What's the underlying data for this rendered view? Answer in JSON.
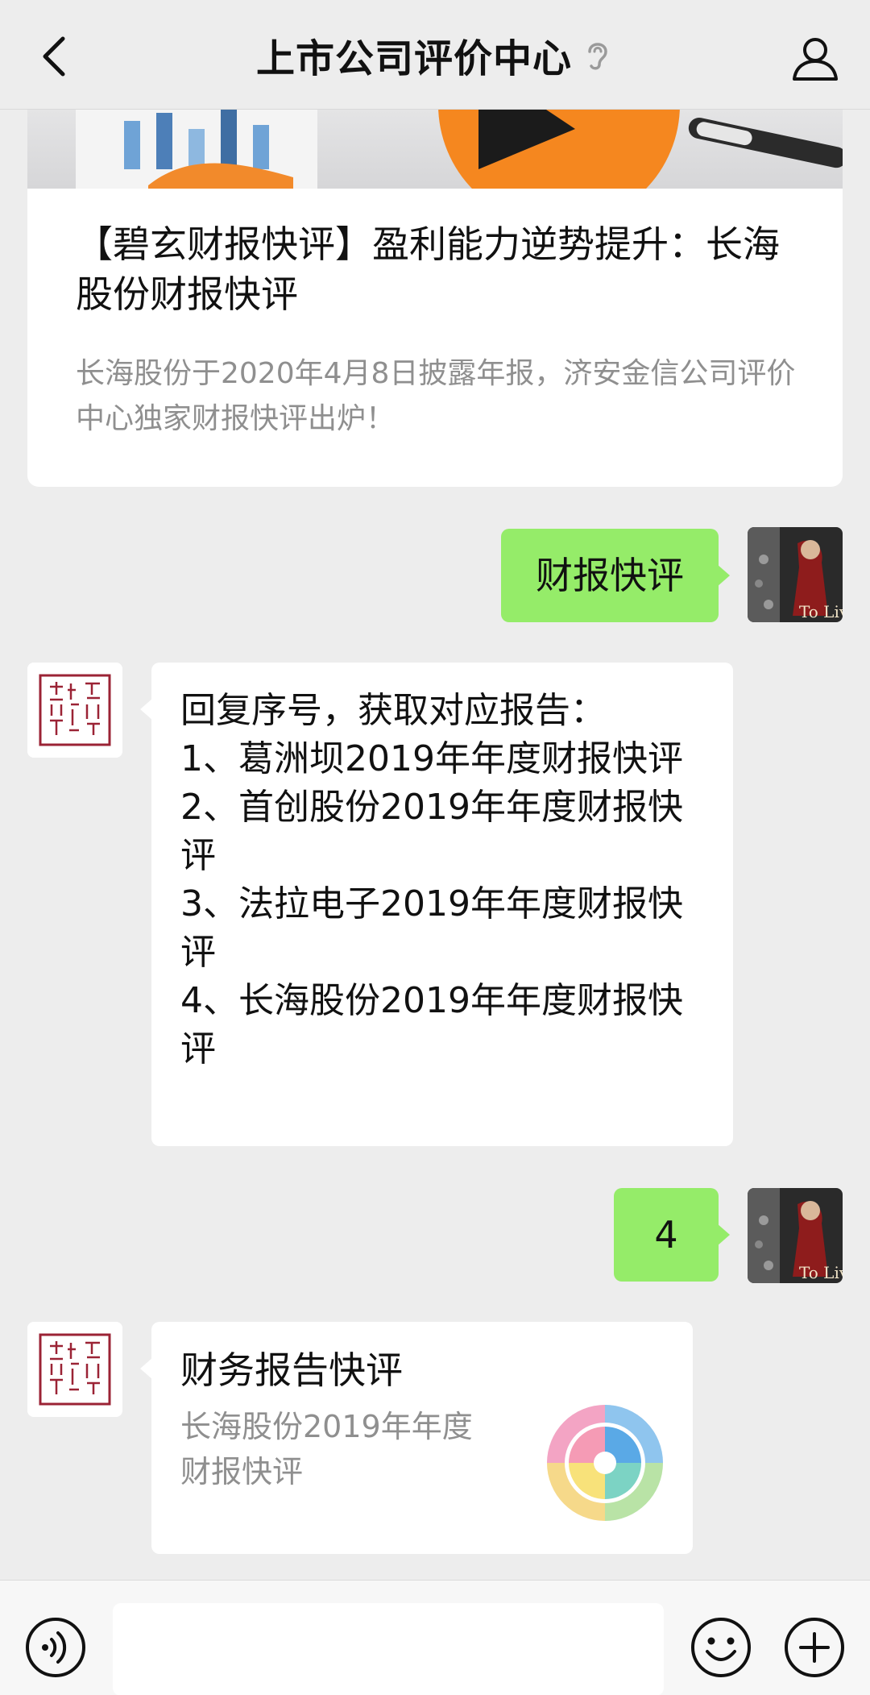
{
  "header": {
    "title": "上市公司评价中心",
    "back_icon": "chevron-left-icon",
    "ear_icon": "ear-icon",
    "profile_icon": "person-icon"
  },
  "article": {
    "title": "【碧玄财报快评】盈利能力逆势提升：长海股份财报快评",
    "description": "长海股份于2020年4月8日披露年报，济安金信公司评价中心独家财报快评出炉！"
  },
  "messages": [
    {
      "from": "user",
      "text": "财报快评"
    },
    {
      "from": "org",
      "intro": "回复序号，获取对应报告：",
      "items": [
        "1、葛洲坝2019年年度财报快评",
        "2、首创股份2019年年度财报快评",
        "3、法拉电子2019年年度财报快评",
        "4、长海股份2019年年度财报快评"
      ]
    },
    {
      "from": "user",
      "text": "4"
    },
    {
      "from": "org",
      "card_title": "财务报告快评",
      "card_desc": "长海股份2019年年度财报快评"
    }
  ],
  "user_avatar": {
    "caption": "To Live"
  },
  "input_bar": {
    "voice_icon": "voice-icon",
    "emoji_icon": "emoji-icon",
    "plus_icon": "plus-icon"
  },
  "colors": {
    "background": "#ededed",
    "bubble_green": "#95ec69",
    "seal_red": "#9b2335"
  }
}
